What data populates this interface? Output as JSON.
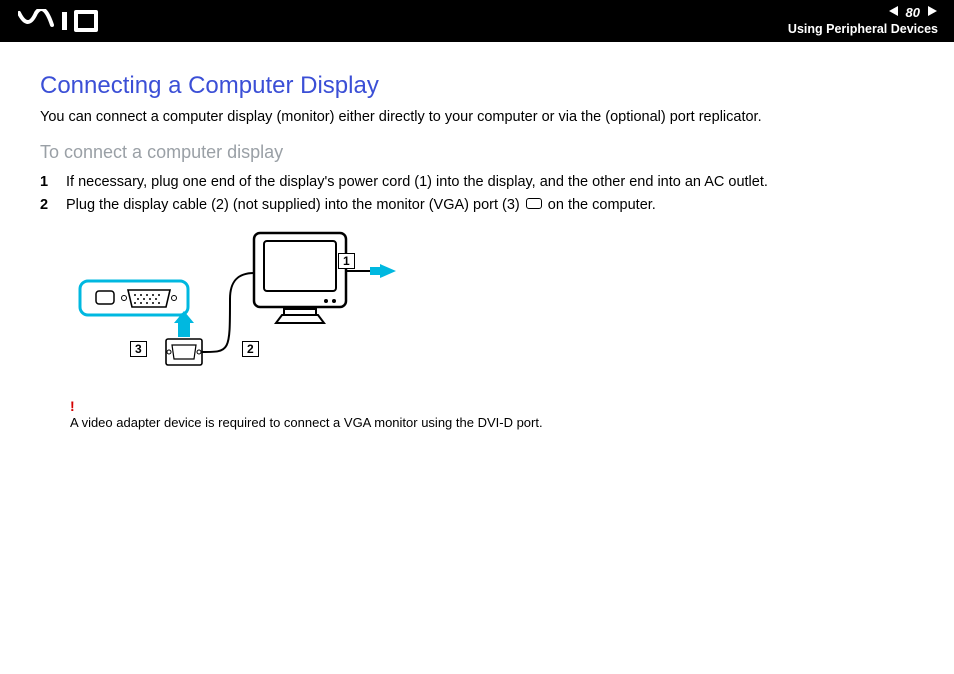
{
  "header": {
    "page_number": "80",
    "section": "Using Peripheral Devices"
  },
  "title": "Connecting a Computer Display",
  "intro": "You can connect a computer display (monitor) either directly to your computer or via the (optional) port replicator.",
  "subhead": "To connect a computer display",
  "steps": [
    {
      "n": "1",
      "text": "If necessary, plug one end of the display's power cord (1) into the display, and the other end into an AC outlet."
    },
    {
      "n": "2",
      "text_a": "Plug the display cable (2) (not supplied) into the monitor (VGA) port (3) ",
      "text_b": " on the computer."
    }
  ],
  "callouts": {
    "c1": "1",
    "c2": "2",
    "c3": "3"
  },
  "note": {
    "bang": "!",
    "text": "A video adapter device is required to connect a VGA monitor using the DVI-D port."
  }
}
